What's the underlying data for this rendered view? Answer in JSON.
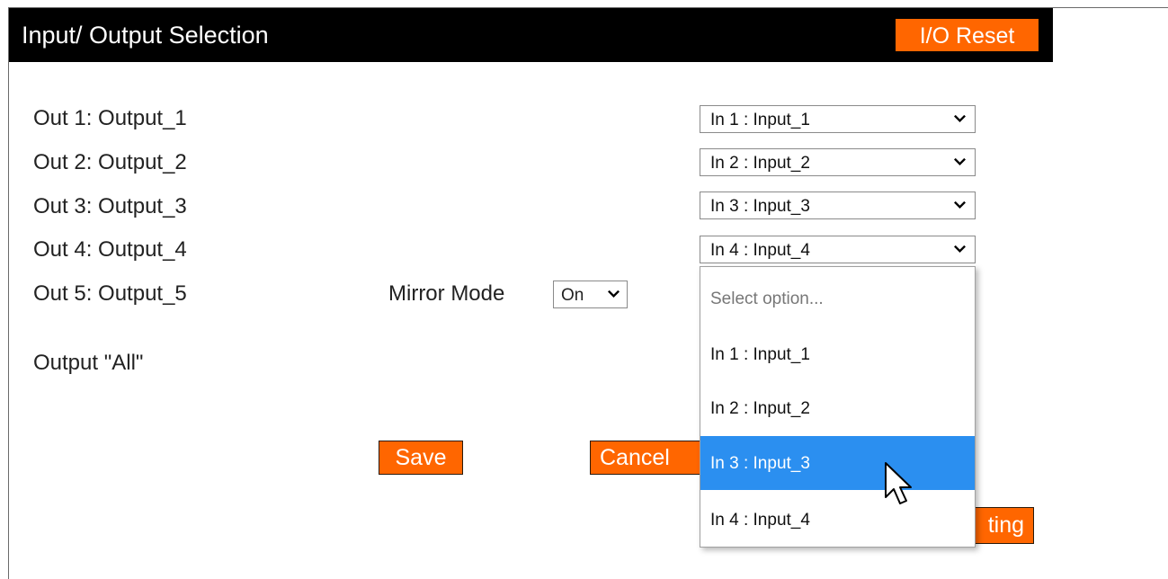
{
  "header": {
    "title": "Input/ Output Selection",
    "reset_label": "I/O Reset"
  },
  "rows": [
    {
      "label": "Out 1: Output_1",
      "selected": "In 1 : Input_1"
    },
    {
      "label": "Out 2: Output_2",
      "selected": "In 2 : Input_2"
    },
    {
      "label": "Out 3: Output_3",
      "selected": "In 3 : Input_3"
    },
    {
      "label": "Out 4: Output_4",
      "selected": "In 4 : Input_4"
    },
    {
      "label": "Out 5: Output_5"
    },
    {
      "label": "Output \"All\""
    }
  ],
  "mirror": {
    "label": "Mirror Mode",
    "value": "On"
  },
  "dropdown": {
    "placeholder": "Select option...",
    "options": [
      "In 1 : Input_1",
      "In 2 : Input_2",
      "In 3 : Input_3",
      "In 4 : Input_4"
    ],
    "highlighted": "In 3 : Input_3"
  },
  "buttons": {
    "save": "Save",
    "cancel": "Cancel",
    "setting_partial": "ting"
  },
  "colors": {
    "accent": "#ff6600",
    "header_bg": "#000000",
    "highlight": "#2b8ff0"
  }
}
